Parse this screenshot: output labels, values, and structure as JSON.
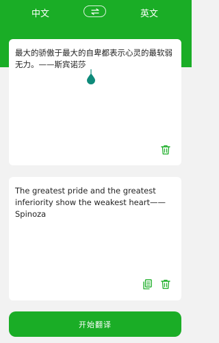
{
  "header": {
    "source_language": "中文",
    "target_language": "英文",
    "swap_icon": "swap-arrows-icon"
  },
  "input_card": {
    "text": "最大的骄傲于最大的自卑都表示心灵的最软弱无力。——斯宾诺莎",
    "delete_icon": "trash-icon"
  },
  "output_card": {
    "text": "The greatest pride and the greatest inferiority show the weakest heart——Spinoza",
    "copy_icon": "copy-icon",
    "delete_icon": "trash-icon"
  },
  "translate_button": {
    "label": "开始翻译"
  },
  "colors": {
    "brand_green": "#1aad26",
    "cursor_teal": "#0e8a7a"
  }
}
